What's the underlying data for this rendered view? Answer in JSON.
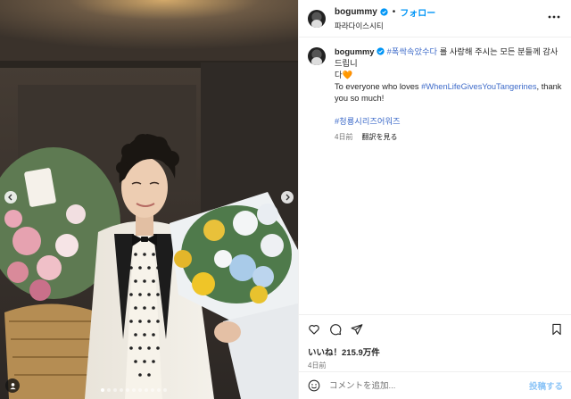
{
  "post": {
    "username": "bogummy",
    "separator": "•",
    "follow_label": "フォロー",
    "location": "파라다이스시티",
    "caption": {
      "username": "bogummy",
      "hashtag1": "#폭싹속았수다",
      "text_kr_1": " 를 사랑해 주시는 모든 분들께 감사드립니",
      "text_kr_2": "다",
      "emoji": "🧡",
      "text_en_1": "To everyone who loves ",
      "hashtag2": "#WhenLifeGivesYouTangerines",
      "text_en_2": ", thank",
      "text_en_3": "you so much!",
      "hashtag3": "#청룡시리즈어워즈"
    },
    "caption_time": "4日前",
    "translate_label": "翻訳を見る",
    "likes_text": "いいね！215.9万件",
    "date_text": "4日前"
  },
  "comment": {
    "placeholder": "コメントを追加...",
    "post_label": "投稿する"
  },
  "carousel": {
    "total_slides": 11,
    "active_index": 0
  },
  "icons": {
    "verified": "verified-badge-icon",
    "more": "more-options-icon",
    "like": "heart-icon",
    "comment": "comment-icon",
    "share": "share-icon",
    "save": "bookmark-icon",
    "emoji": "emoji-icon",
    "prev": "chevron-left-icon",
    "next": "chevron-right-icon",
    "tag": "user-tag-icon"
  },
  "colors": {
    "accent": "#0095f6",
    "hashtag": "#3e6bc9",
    "muted": "#737373",
    "post_disabled": "#8dc5f7"
  }
}
